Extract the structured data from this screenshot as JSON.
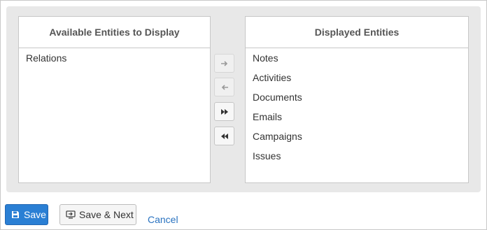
{
  "available": {
    "title": "Available Entities to Display",
    "items": [
      "Relations"
    ]
  },
  "displayed": {
    "title": "Displayed Entities",
    "items": [
      "Notes",
      "Activities",
      "Documents",
      "Emails",
      "Campaigns",
      "Issues"
    ]
  },
  "movers": [
    {
      "icon": "arrow-right-icon",
      "enabled": false
    },
    {
      "icon": "arrow-left-icon",
      "enabled": false
    },
    {
      "icon": "double-chevron-right-icon",
      "enabled": true
    },
    {
      "icon": "double-chevron-left-icon",
      "enabled": true
    }
  ],
  "footer": {
    "save_label": "Save",
    "save_icon": "floppy-disk-icon",
    "save_next_label": "Save & Next",
    "save_next_icon": "save-next-icon",
    "cancel_label": "Cancel"
  },
  "colors": {
    "primary": "#2a7fd4",
    "link": "#2a73c0",
    "panel_bg": "#e8e8e8"
  }
}
